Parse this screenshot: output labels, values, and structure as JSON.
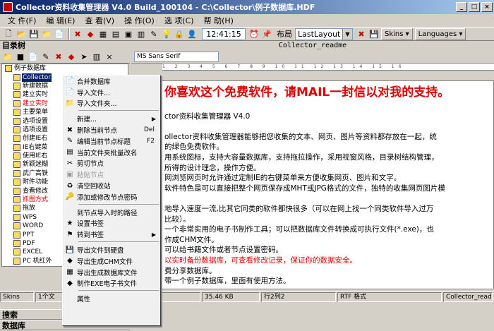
{
  "window": {
    "title": "Collector资料收集管理器 V4.0 Build_100104 - C:\\Collector\\例子数据库.HDF",
    "min_label": "_",
    "max_label": "□",
    "close_label": "×"
  },
  "menu": [
    "文 件(F)",
    "编 辑(E)",
    "查 看(V)",
    "操 作(O)",
    "选 项(C)",
    "帮 助(H)"
  ],
  "toolbar": {
    "clock": "12:41:15",
    "layout_label": "布局",
    "layout_value": "LastLayout",
    "skins_label": "Skins",
    "languages_label": "Languages"
  },
  "left_panel": {
    "title": "目录树",
    "tree": [
      {
        "label": "例子数据库",
        "state": "normal"
      },
      {
        "label": "Collector",
        "state": "selected"
      },
      {
        "label": "新建数据",
        "state": "normal"
      },
      {
        "label": "建立实时",
        "state": "normal"
      },
      {
        "label": "建立实时",
        "state": "red"
      },
      {
        "label": "主要菜单",
        "state": "normal"
      },
      {
        "label": "选项设置",
        "state": "normal"
      },
      {
        "label": "选项设置",
        "state": "normal"
      },
      {
        "label": "创建IE右",
        "state": "normal"
      },
      {
        "label": "IE右键菜",
        "state": "normal"
      },
      {
        "label": "使用IE右",
        "state": "normal"
      },
      {
        "label": "新颖迷糊",
        "state": "normal"
      },
      {
        "label": "武广高铁",
        "state": "normal"
      },
      {
        "label": "附件功能",
        "state": "normal"
      },
      {
        "label": "查看修改",
        "state": "normal"
      },
      {
        "label": "抓图方式",
        "state": "red"
      },
      {
        "label": "拖放",
        "state": "normal"
      },
      {
        "label": "WPS",
        "state": "normal"
      },
      {
        "label": "WORD",
        "state": "normal"
      },
      {
        "label": "PPT",
        "state": "normal"
      },
      {
        "label": "PDF",
        "state": "normal"
      },
      {
        "label": "EXCEL",
        "state": "normal"
      },
      {
        "label": "PC 机红外",
        "state": "normal"
      }
    ],
    "bottom_tabs": [
      "搜索",
      "数据库"
    ]
  },
  "right_panel": {
    "title": "Collector_readme",
    "font": "MS Sans Serif",
    "ruler": "1 2 3 4 5 6 7 8 9 10 11 12 13 14 15 16",
    "lines": [
      {
        "text": "你喜欢这个免费软件，请MAIL一封信以对我的支持。",
        "style": "big"
      },
      {
        "text": "",
        "style": "normal"
      },
      {
        "text": "ctor资料收集管理器 V4.0",
        "style": "normal"
      },
      {
        "text": "",
        "style": "normal"
      },
      {
        "text": "ollector资料收集管理器能够把您收集的文本、网页、图片等资料都存放在一起，统",
        "style": "normal"
      },
      {
        "text": "的绿色免费软件。",
        "style": "normal"
      },
      {
        "text": "用系统图标，支持大容量数据库，支持拖拉操作，采用视窗风格，目录树结构管理，",
        "style": "normal"
      },
      {
        "text": "所得的设计理念，操作方便。",
        "style": "normal"
      },
      {
        "text": "网浏览网页时允许通过定制IE的右键菜单来方便收集网页、图片和文字。",
        "style": "normal"
      },
      {
        "text": "软件特色是可以直接把整个网页保存成MHT或JPG格式的文件，独特的收集网页图片模",
        "style": "normal"
      },
      {
        "text": "",
        "style": "normal"
      },
      {
        "text": "地导入速度一流,比其它同类的软件都快很多（可以在网上找一个同类软件导入过万",
        "style": "normal"
      },
      {
        "text": "比较）。",
        "style": "normal"
      },
      {
        "text": "一个非常实用的电子书制作工具；可以把数据库文件转换成可执行文件(*.exe)，也",
        "style": "normal"
      },
      {
        "text": "作成CHM文件。",
        "style": "normal"
      },
      {
        "text": "可以给书籍文件或者节点设置密码。",
        "style": "normal"
      },
      {
        "text": "以实时备份数据库，可查看修改记录，保证你的数据安全。",
        "style": "red"
      },
      {
        "text": "费分享数据库。",
        "style": "normal"
      },
      {
        "text": "带一个例子数据库，里面有使用方法。",
        "style": "normal"
      }
    ]
  },
  "status": {
    "skins": "Skins",
    "count": "1个文",
    "size": "35.46 KB",
    "row": "行2列2",
    "format": "RTF 格式",
    "doc": "Collector_read"
  },
  "context_menu": [
    {
      "label": "合并数据库",
      "icon": "📄",
      "key": "",
      "sub": false,
      "disabled": false,
      "sep_before": false
    },
    {
      "label": "导入文件...",
      "icon": "📄",
      "key": "",
      "sub": false,
      "disabled": false,
      "sep_before": false
    },
    {
      "label": "导入文件夹...",
      "icon": "📁",
      "key": "",
      "sub": false,
      "disabled": false,
      "sep_before": false
    },
    {
      "label": "新建...",
      "icon": "",
      "key": "",
      "sub": true,
      "disabled": false,
      "sep_before": true
    },
    {
      "label": "删除当前节点",
      "icon": "✖",
      "key": "Del",
      "sub": false,
      "disabled": false,
      "sep_before": false
    },
    {
      "label": "编辑当前节点标题",
      "icon": "✎",
      "key": "F2",
      "sub": false,
      "disabled": false,
      "sep_before": false
    },
    {
      "label": "当前文件夹批量改名",
      "icon": "▤",
      "key": "",
      "sub": false,
      "disabled": false,
      "sep_before": false
    },
    {
      "label": "剪切节点",
      "icon": "✂",
      "key": "",
      "sub": false,
      "disabled": false,
      "sep_before": false
    },
    {
      "label": "粘贴节点",
      "icon": "▣",
      "key": "",
      "sub": false,
      "disabled": true,
      "sep_before": false
    },
    {
      "label": "清空回收站",
      "icon": "♻",
      "key": "",
      "sub": false,
      "disabled": false,
      "sep_before": false
    },
    {
      "label": "添加或修改节点密码",
      "icon": "🔑",
      "key": "",
      "sub": false,
      "disabled": false,
      "sep_before": false
    },
    {
      "label": "到节点导入时的路径",
      "icon": "",
      "key": "",
      "sub": false,
      "disabled": false,
      "sep_before": true
    },
    {
      "label": "设置书签",
      "icon": "★",
      "key": "",
      "sub": false,
      "disabled": false,
      "sep_before": false
    },
    {
      "label": "转到书签",
      "icon": "⚑",
      "key": "",
      "sub": true,
      "disabled": false,
      "sep_before": false
    },
    {
      "label": "导出文件到硬盘",
      "icon": "💾",
      "key": "",
      "sub": false,
      "disabled": false,
      "sep_before": true
    },
    {
      "label": "导出生成CHM文件",
      "icon": "◆",
      "key": "",
      "sub": false,
      "disabled": false,
      "sep_before": false
    },
    {
      "label": "导出生成数据库文件",
      "icon": "▦",
      "key": "",
      "sub": false,
      "disabled": false,
      "sep_before": false
    },
    {
      "label": "制作EXE电子书文件",
      "icon": "◆",
      "key": "",
      "sub": false,
      "disabled": false,
      "sep_before": false
    },
    {
      "label": "属性",
      "icon": "",
      "key": "",
      "sub": false,
      "disabled": false,
      "sep_before": true
    }
  ],
  "colors": {
    "accent": "#0a246a",
    "highlight_text": "#dd0000",
    "menu_bg": "#f0f0f0"
  }
}
